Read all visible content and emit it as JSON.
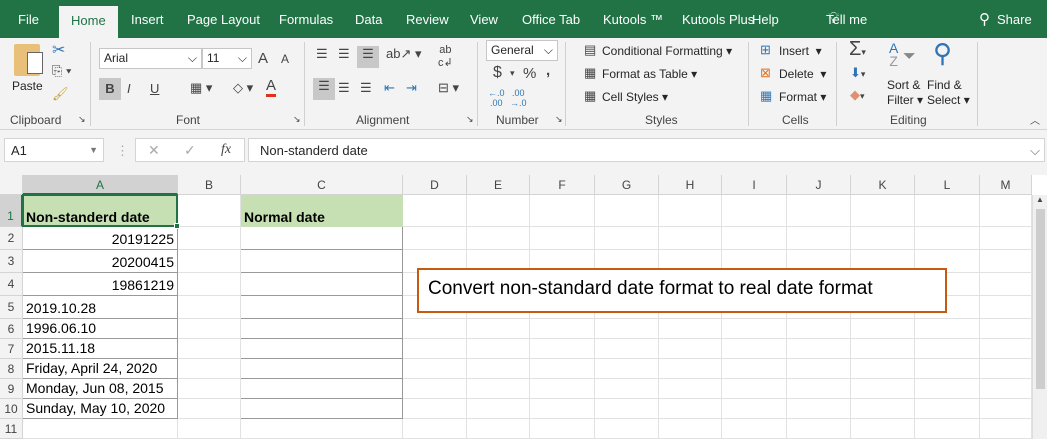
{
  "tabs": [
    "File",
    "Home",
    "Insert",
    "Page Layout",
    "Formulas",
    "Data",
    "Review",
    "View",
    "Office Tab",
    "Kutools ™",
    "Kutools Plus",
    "Help",
    "Tell me",
    "Share"
  ],
  "ribbon": {
    "clipboard": {
      "paste": "Paste",
      "label": "Clipboard"
    },
    "font": {
      "name": "Arial",
      "size": "11",
      "bold": "B",
      "italic": "I",
      "underline": "U",
      "label": "Font"
    },
    "alignment": {
      "label": "Alignment"
    },
    "number": {
      "format": "General",
      "currency": "$",
      "percent": "%",
      "comma": ",",
      "label": "Number"
    },
    "styles": {
      "conditional": "Conditional Formatting",
      "table": "Format as Table",
      "cell": "Cell Styles",
      "label": "Styles"
    },
    "cells": {
      "insert": "Insert",
      "delete": "Delete",
      "format": "Format",
      "label": "Cells"
    },
    "editing": {
      "sort1": "Sort &",
      "sort2": "Filter",
      "find1": "Find &",
      "find2": "Select",
      "label": "Editing"
    }
  },
  "formula_bar": {
    "name_box": "A1",
    "fx": "fx",
    "value": "Non-standerd date"
  },
  "columns": [
    "A",
    "B",
    "C",
    "D",
    "E",
    "F",
    "G",
    "H",
    "I",
    "J",
    "K",
    "L",
    "M"
  ],
  "rows": [
    "1",
    "2",
    "3",
    "4",
    "5",
    "6",
    "7",
    "8",
    "9",
    "10",
    "11"
  ],
  "cells": {
    "A": [
      "Non-standerd date",
      "20191225",
      "20200415",
      "19861219",
      "2019.10.28",
      "1996.06.10",
      "2015.11.18",
      "Friday, April 24, 2020",
      "Monday, Jun 08, 2015",
      "Sunday, May 10, 2020"
    ],
    "C": [
      "Normal date"
    ]
  },
  "textbox": "Convert non-standard date format to real date format",
  "colors": {
    "brand": "#217346",
    "header_fill": "#c6e0b4",
    "textbox_border": "#c55a11"
  }
}
